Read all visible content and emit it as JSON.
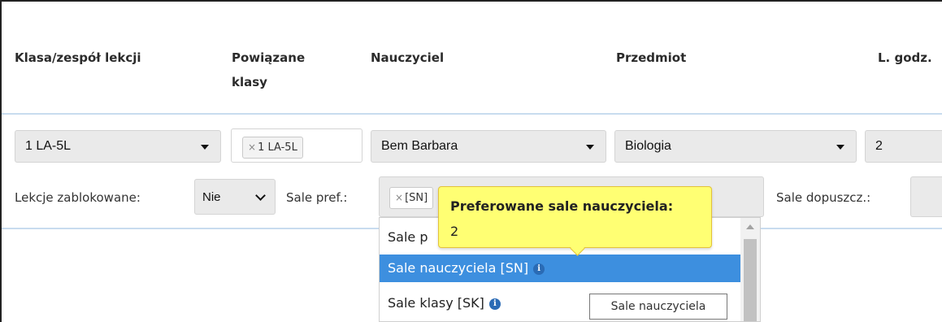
{
  "table": {
    "headers": {
      "class_group": "Klasa/zespół lekcji",
      "linked_classes_line1": "Powiązane",
      "linked_classes_line2": "klasy",
      "teacher": "Nauczyciel",
      "subject": "Przedmiot",
      "hours": "L. godz."
    },
    "row": {
      "class_group_value": "1 LA-5L",
      "linked_class_tag": "1 LA-5L",
      "teacher_value": "Bem Barbara",
      "subject_value": "Biologia",
      "hours_value": "2"
    }
  },
  "options_row": {
    "locked_label": "Lekcje zablokowane:",
    "locked_value": "Nie",
    "pref_rooms_label": "Sale pref.:",
    "pref_rooms_tag": "[SN]",
    "allowed_rooms_label": "Sale dopuszcz.:"
  },
  "dropdown": {
    "options": [
      {
        "label": "Sale p",
        "selected": false
      },
      {
        "label": "Sale nauczyciela [SN]",
        "selected": true
      },
      {
        "label": "Sale klasy [SK]",
        "selected": false
      }
    ]
  },
  "tooltip": {
    "title": "Preferowane sale nauczyciela:",
    "value": "2"
  },
  "hover_hint": "Sale nauczyciela",
  "colors": {
    "selected_option": "#3d8fdf",
    "tooltip_bg": "#ffff73",
    "separator": "#c8dcef"
  },
  "icons": {
    "remove_tag": "×",
    "info": "i"
  }
}
